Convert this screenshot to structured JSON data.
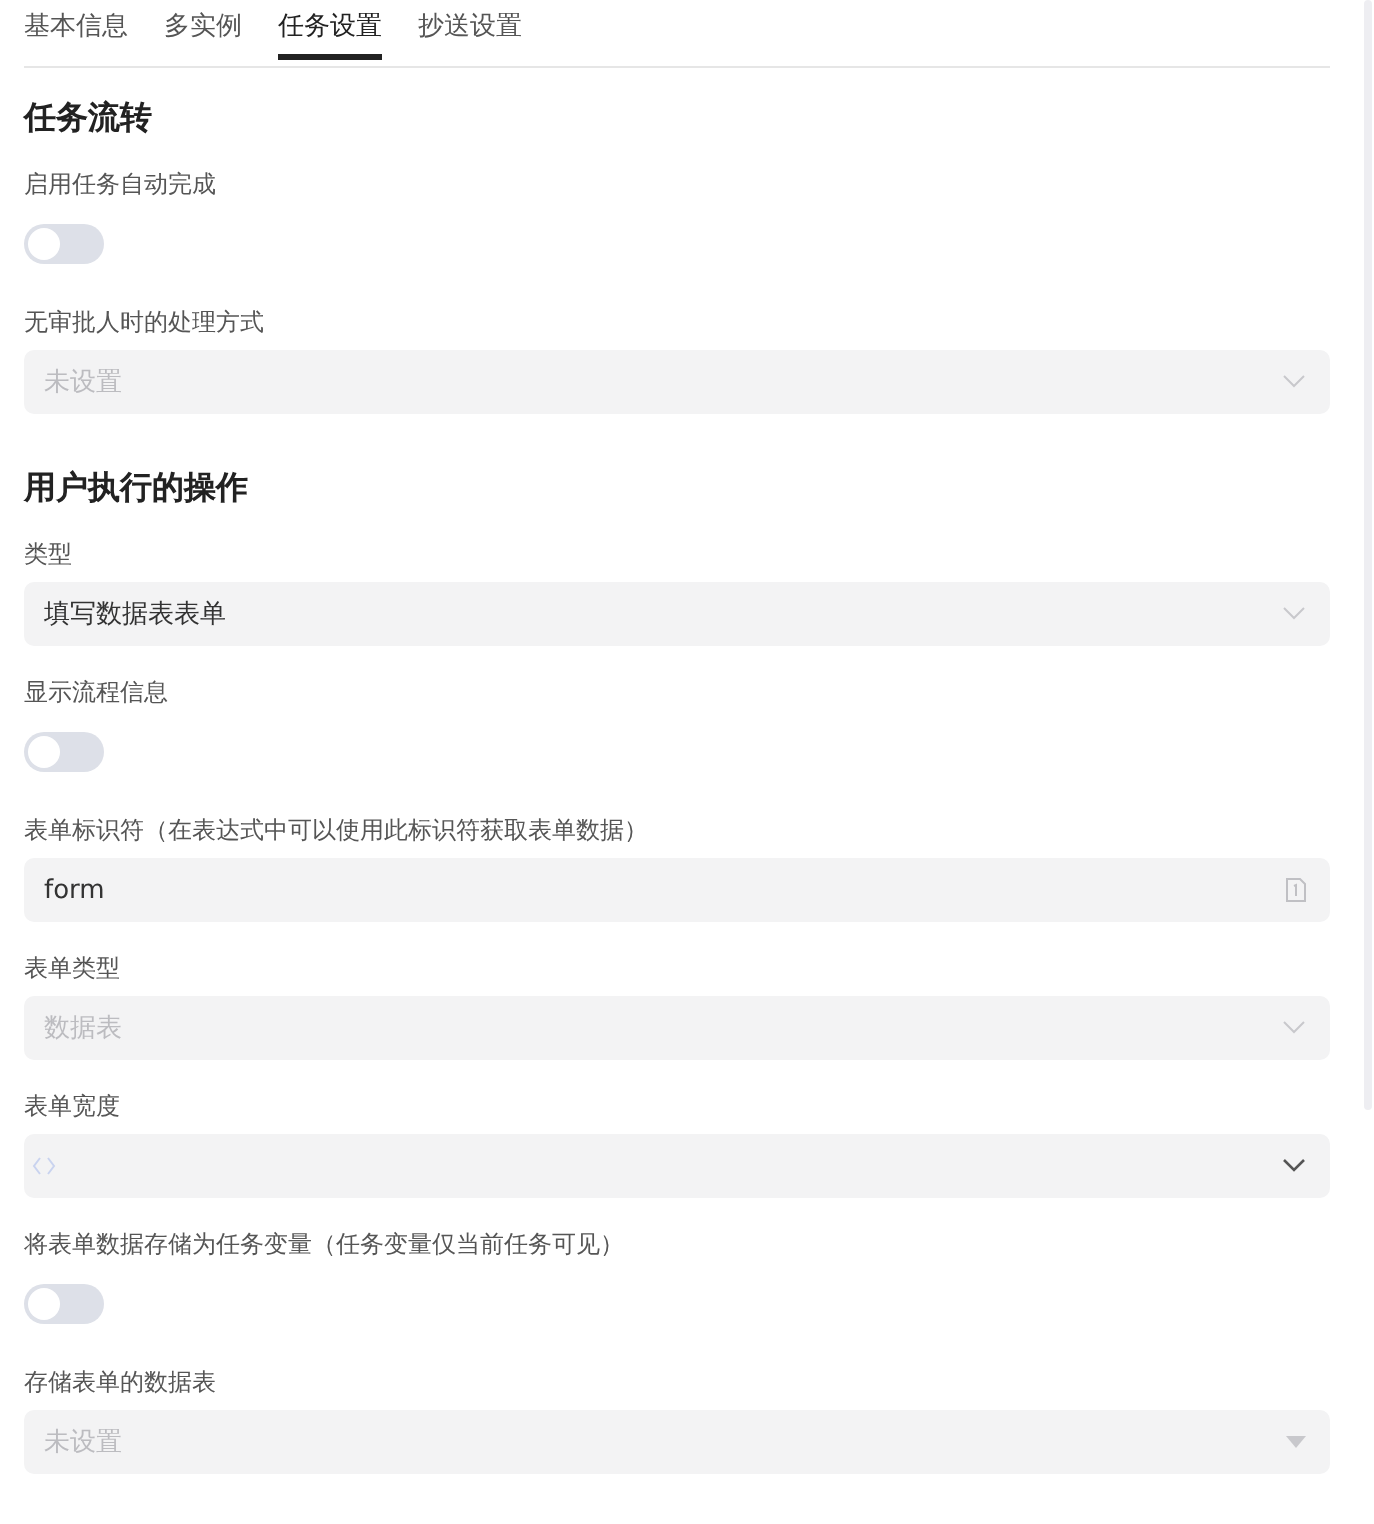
{
  "tabs": [
    {
      "label": "基本信息",
      "selected": false
    },
    {
      "label": "多实例",
      "selected": false
    },
    {
      "label": "任务设置",
      "selected": true
    },
    {
      "label": "抄送设置",
      "selected": false
    }
  ],
  "sections": [
    {
      "title": "任务流转",
      "fields": [
        {
          "kind": "toggle",
          "label": "启用任务自动完成",
          "on": false
        },
        {
          "kind": "select",
          "label": "无审批人时的处理方式",
          "placeholder": "未设置"
        }
      ]
    },
    {
      "title": "用户执行的操作",
      "fields": [
        {
          "kind": "select",
          "label": "类型",
          "value": "填写数据表表单"
        },
        {
          "kind": "toggle",
          "label": "显示流程信息",
          "on": false
        },
        {
          "kind": "input",
          "label": "表单标识符（在表达式中可以使用此标识符获取表单数据）",
          "value": "form"
        },
        {
          "kind": "select",
          "label": "表单类型",
          "placeholder": "数据表"
        },
        {
          "kind": "code-select",
          "label": "表单宽度"
        },
        {
          "kind": "toggle",
          "label": "将表单数据存储为任务变量（任务变量仅当前任务可见）",
          "on": false
        },
        {
          "kind": "caret-select",
          "label": "存储表单的数据表",
          "placeholder": "未设置"
        }
      ]
    }
  ]
}
